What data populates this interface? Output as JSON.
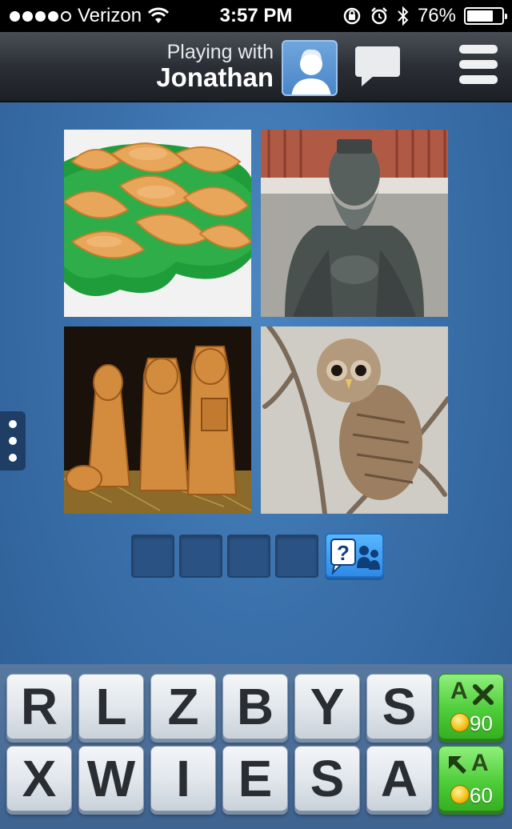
{
  "status_bar": {
    "carrier": "Verizon",
    "time": "3:57 PM",
    "battery": "76%",
    "battery_level": 0.76
  },
  "header": {
    "playing_with_label": "Playing with",
    "opponent_name": "Jonathan"
  },
  "answer": {
    "slot_count": 4
  },
  "keyboard": {
    "row1": [
      "R",
      "L",
      "Z",
      "B",
      "Y",
      "S"
    ],
    "row2": [
      "X",
      "W",
      "I",
      "E",
      "S",
      "A"
    ],
    "remove_letters_cost": "90",
    "reveal_letter_cost": "60",
    "remove_icon_letter": "A",
    "reveal_icon_letter": "A"
  },
  "colors": {
    "background": "#3a70aa",
    "header": "#2b2f35",
    "key_face": "#e2e7ec",
    "powerup_green": "#4fcd3a",
    "hint_blue": "#2f8ae6"
  },
  "icons": [
    "wifi-icon",
    "lock-rotation-icon",
    "alarm-icon",
    "bluetooth-icon",
    "battery-icon",
    "avatar-icon",
    "chat-bubble-icon",
    "menu-icon",
    "side-menu-dots-icon",
    "question-friends-icon",
    "coin-icon"
  ]
}
